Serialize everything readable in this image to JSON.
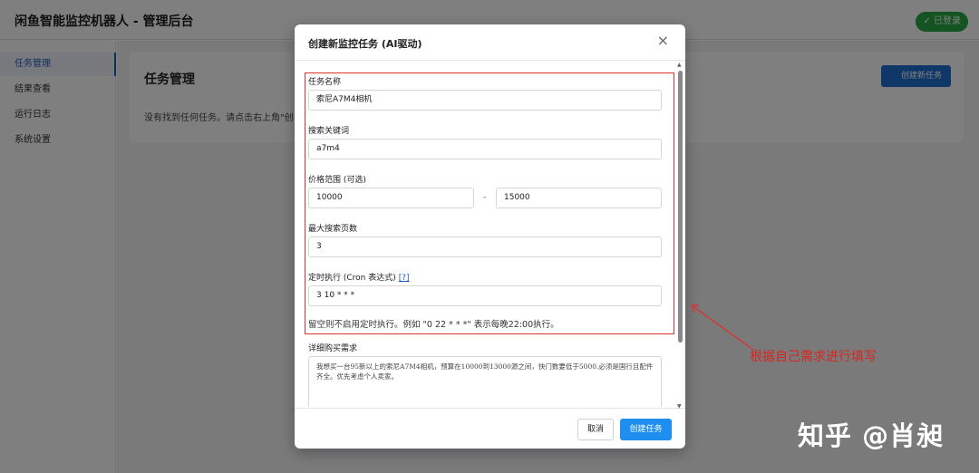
{
  "app": {
    "title": "闲鱼智能监控机器人 - 管理后台",
    "login_status": "✓ 已登录"
  },
  "sidebar": {
    "items": [
      {
        "label": "任务管理",
        "active": true
      },
      {
        "label": "结果查看",
        "active": false
      },
      {
        "label": "运行日志",
        "active": false
      },
      {
        "label": "系统设置",
        "active": false
      }
    ]
  },
  "main": {
    "title": "任务管理",
    "empty_text": "没有找到任何任务。请点击右上角\"创",
    "create_button": "创建新任务"
  },
  "modal": {
    "title": "创建新监控任务 (AI驱动)",
    "close_glyph": "×",
    "fields": {
      "task_name": {
        "label": "任务名称",
        "value": "索尼A7M4相机"
      },
      "keyword": {
        "label": "搜索关键词",
        "value": "a7m4"
      },
      "price_range": {
        "label": "价格范围 (可选)",
        "min": "10000",
        "separator": "-",
        "max": "15000"
      },
      "max_pages": {
        "label": "最大搜索页数",
        "value": "3"
      },
      "cron": {
        "label": "定时执行 (Cron 表达式)",
        "help": "[?]",
        "value": "3 10 * * *",
        "hint": "留空则不启用定时执行。例如 \"0 22 * * *\" 表示每晚22:00执行。"
      },
      "description": {
        "label": "详细购买需求",
        "value": "我想买一台95新以上的索尼A7M4相机，预算在10000到13000源之间，快门数要低于5000.必须是国行且配件齐全。优先考虑个人卖家。"
      }
    },
    "cancel_button": "取消",
    "submit_button": "创建任务"
  },
  "annotation": {
    "text": "根据自己需求进行填写",
    "color": "#d8261f"
  },
  "watermark": {
    "text": "知乎 @肖昶"
  },
  "colors": {
    "primary": "#1e8ff0",
    "success": "#28a745",
    "highlight": "#e0302a"
  }
}
